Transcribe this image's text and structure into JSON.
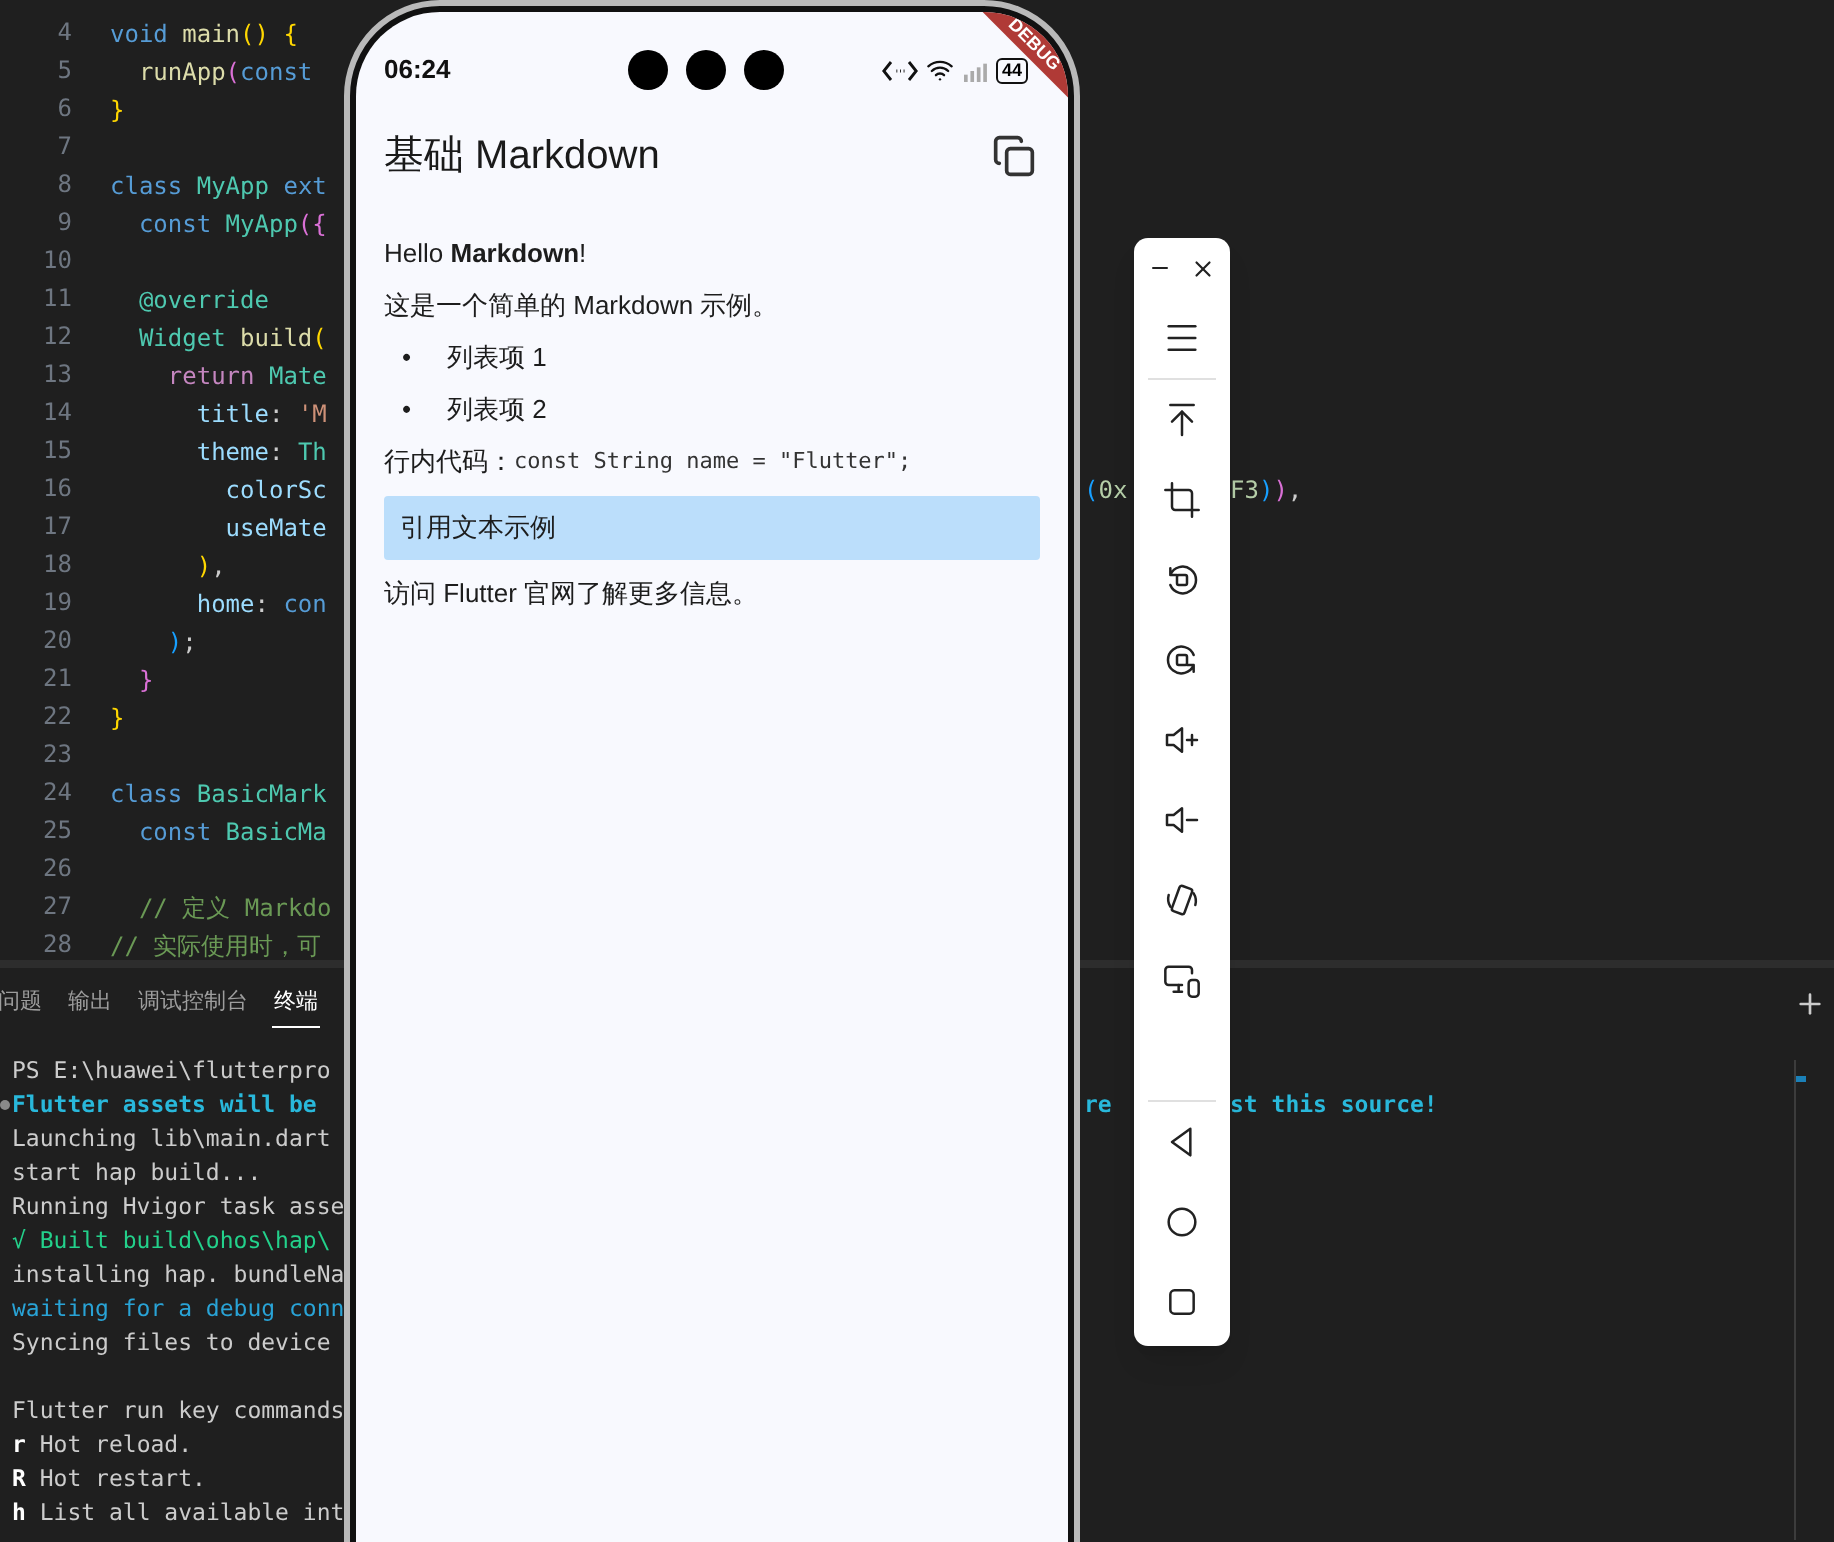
{
  "editor": {
    "lines": [
      {
        "number": "4",
        "tokens": [
          {
            "text": "void ",
            "kind": "kw"
          },
          {
            "text": "main",
            "kind": "fn"
          },
          {
            "text": "() {",
            "kind": "br1"
          }
        ]
      },
      {
        "number": "5",
        "tokens": [
          {
            "text": "  runApp",
            "kind": "fn"
          },
          {
            "text": "(",
            "kind": "br2"
          },
          {
            "text": "const",
            "kind": "kw"
          }
        ]
      },
      {
        "number": "6",
        "tokens": [
          {
            "text": "}",
            "kind": "br1"
          }
        ]
      },
      {
        "number": "7"
      },
      {
        "number": "8",
        "tokens": [
          {
            "text": "class ",
            "kind": "kw"
          },
          {
            "text": "MyApp ",
            "kind": "type"
          },
          {
            "text": "ext",
            "kind": "kw"
          }
        ]
      },
      {
        "number": "9",
        "tokens": [
          {
            "text": "  const ",
            "kind": "kw"
          },
          {
            "text": "MyApp",
            "kind": "type"
          },
          {
            "text": "({",
            "kind": "br2"
          }
        ]
      },
      {
        "number": "10"
      },
      {
        "number": "11",
        "tokens": [
          {
            "text": "  @override",
            "kind": "type"
          }
        ]
      },
      {
        "number": "12",
        "tokens": [
          {
            "text": "  Widget ",
            "kind": "type"
          },
          {
            "text": "build",
            "kind": "fn"
          },
          {
            "text": "(",
            "kind": "br1"
          }
        ]
      },
      {
        "number": "13",
        "tokens": [
          {
            "text": "    return ",
            "kind": "ctl"
          },
          {
            "text": "Mate",
            "kind": "type"
          }
        ]
      },
      {
        "number": "14",
        "tokens": [
          {
            "text": "      title",
            "kind": "prop"
          },
          {
            "text": ": ",
            "kind": "punc"
          },
          {
            "text": "'M",
            "kind": "str"
          }
        ]
      },
      {
        "number": "15",
        "tokens": [
          {
            "text": "      theme",
            "kind": "prop"
          },
          {
            "text": ": ",
            "kind": "punc"
          },
          {
            "text": "Th",
            "kind": "type"
          }
        ]
      },
      {
        "number": "16",
        "tokens": [
          {
            "text": "        colorSc",
            "kind": "prop"
          }
        ],
        "after_phone": [
          {
            "text": "(",
            "kind": "br3"
          },
          {
            "text": "0x",
            "kind": "num"
          }
        ],
        "after_toolbar": [
          {
            "text": "F3",
            "kind": "num"
          },
          {
            "text": ")",
            "kind": "br3"
          },
          {
            "text": ")",
            "kind": "br2"
          },
          {
            "text": ",",
            "kind": "punc"
          }
        ]
      },
      {
        "number": "17",
        "tokens": [
          {
            "text": "        useMate",
            "kind": "prop"
          }
        ]
      },
      {
        "number": "18",
        "tokens": [
          {
            "text": "      )",
            "kind": "br1"
          },
          {
            "text": ",",
            "kind": "punc"
          }
        ]
      },
      {
        "number": "19",
        "tokens": [
          {
            "text": "      home",
            "kind": "prop"
          },
          {
            "text": ": ",
            "kind": "punc"
          },
          {
            "text": "con",
            "kind": "kw"
          }
        ]
      },
      {
        "number": "20",
        "tokens": [
          {
            "text": "    )",
            "kind": "br3"
          },
          {
            "text": ";",
            "kind": "punc"
          }
        ]
      },
      {
        "number": "21",
        "tokens": [
          {
            "text": "  }",
            "kind": "br2"
          }
        ]
      },
      {
        "number": "22",
        "tokens": [
          {
            "text": "}",
            "kind": "br1"
          }
        ]
      },
      {
        "number": "23"
      },
      {
        "number": "24",
        "tokens": [
          {
            "text": "class ",
            "kind": "kw"
          },
          {
            "text": "BasicMark",
            "kind": "type"
          }
        ]
      },
      {
        "number": "25",
        "tokens": [
          {
            "text": "  const ",
            "kind": "kw"
          },
          {
            "text": "BasicMa",
            "kind": "type"
          }
        ]
      },
      {
        "number": "26"
      },
      {
        "number": "27",
        "tokens": [
          {
            "text": "  // 定义 Markdo",
            "kind": "comment"
          }
        ]
      },
      {
        "number": "28",
        "tokens": [
          {
            "text": "// 实际使用时，可",
            "kind": "comment"
          }
        ]
      }
    ]
  },
  "terminal": {
    "tabs": [
      {
        "label": "问题",
        "selected": false
      },
      {
        "label": "输出",
        "selected": false
      },
      {
        "label": "调试控制台",
        "selected": false
      },
      {
        "label": "终端",
        "selected": true
      }
    ],
    "lines": [
      {
        "segments": [
          {
            "text": "PS E:\\huawei\\flutterpro",
            "kind": "plain"
          }
        ]
      },
      {
        "marker": true,
        "segments": [
          {
            "text": "Flutter assets will be",
            "kind": "info"
          }
        ],
        "after_phone": [
          {
            "text": "re",
            "kind": "info"
          }
        ],
        "after_toolbar": [
          {
            "text": "st this source!",
            "kind": "info"
          }
        ]
      },
      {
        "segments": [
          {
            "text": "Launching lib\\main.dart",
            "kind": "plain"
          }
        ]
      },
      {
        "segments": [
          {
            "text": "start hap build...",
            "kind": "plain"
          }
        ]
      },
      {
        "segments": [
          {
            "text": "Running Hvigor task asse",
            "kind": "plain"
          }
        ]
      },
      {
        "segments": [
          {
            "text": "√ Built build\\ohos\\hap\\",
            "kind": "success"
          }
        ]
      },
      {
        "segments": [
          {
            "text": "installing hap. bundleNa",
            "kind": "plain"
          }
        ]
      },
      {
        "segments": [
          {
            "text": "waiting for a debug conn",
            "kind": "wait"
          }
        ]
      },
      {
        "segments": [
          {
            "text": "Syncing files to device",
            "kind": "plain"
          }
        ]
      },
      {
        "gap_before": true,
        "segments": [
          {
            "text": "Flutter run key commands",
            "kind": "plain"
          }
        ]
      },
      {
        "segments": [
          {
            "text": "r",
            "kind": "key"
          },
          {
            "text": " Hot reload.",
            "kind": "plain"
          }
        ]
      },
      {
        "segments": [
          {
            "text": "R",
            "kind": "key"
          },
          {
            "text": " Hot restart.",
            "kind": "plain"
          }
        ]
      },
      {
        "segments": [
          {
            "text": "h",
            "kind": "key"
          },
          {
            "text": " List all available int",
            "kind": "plain"
          }
        ]
      }
    ]
  },
  "phone": {
    "status_bar": {
      "time": "06:24",
      "battery": "44"
    },
    "debug_banner": "DEBUG",
    "app_bar": {
      "title": "基础 Markdown"
    },
    "content": [
      {
        "kind": "paragraph",
        "text": "Hello **Markdown**!"
      },
      {
        "kind": "paragraph",
        "text": "这是一个简单的 Markdown 示例。"
      },
      {
        "kind": "bullet",
        "marker": "•",
        "text": "列表项 1"
      },
      {
        "kind": "bullet",
        "marker": "•",
        "text": "列表项 2"
      },
      {
        "kind": "inline_code",
        "label": "行内代码：",
        "code": "const String name = \"Flutter\";"
      },
      {
        "kind": "quote",
        "text": "引用文本示例"
      },
      {
        "kind": "paragraph",
        "text": "访问 Flutter 官网了解更多信息。"
      }
    ]
  }
}
